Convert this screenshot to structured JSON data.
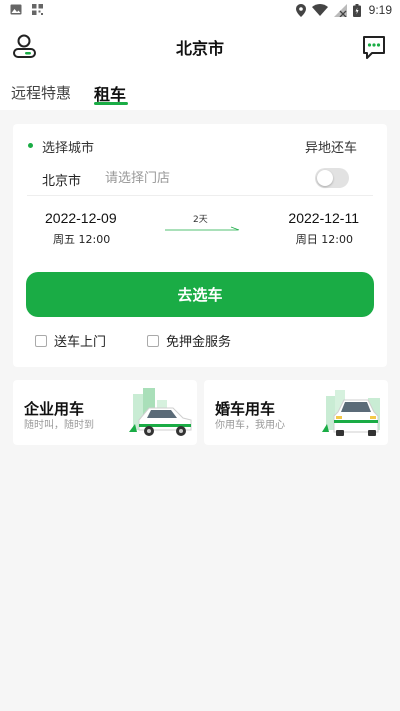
{
  "status_bar": {
    "time": "9:19"
  },
  "header": {
    "title": "北京市"
  },
  "tabs": [
    {
      "label": "远程特惠"
    },
    {
      "label": "租车"
    }
  ],
  "rental_form": {
    "select_city_label": "选择城市",
    "different_return_label": "异地还车",
    "city": "北京市",
    "store_placeholder": "请选择门店",
    "different_return_enabled": false,
    "pickup": {
      "date": "2022-12-09",
      "day_time": "周五 12:00"
    },
    "return": {
      "date": "2022-12-11",
      "day_time": "周日 12:00"
    },
    "duration": "2天",
    "go_button": "去选车",
    "options": [
      {
        "label": "送车上门",
        "checked": false
      },
      {
        "label": "免押金服务",
        "checked": false
      }
    ]
  },
  "promos": [
    {
      "title": "企业用车",
      "subtitle": "随时叫，随时到"
    },
    {
      "title": "婚车用车",
      "subtitle": "你用车，我用心"
    }
  ],
  "colors": {
    "accent": "#1aac45",
    "background": "#f6f6f6"
  }
}
